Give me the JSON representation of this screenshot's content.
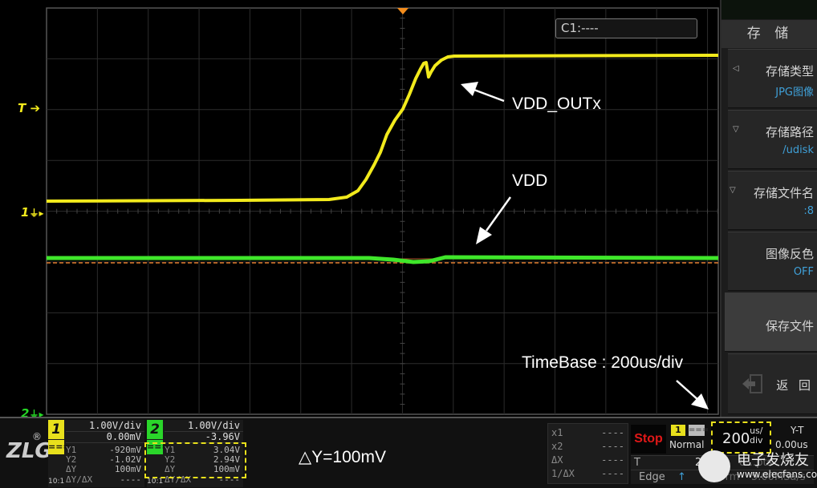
{
  "waveform": {
    "grid_divisions": {
      "horizontal": 14,
      "vertical": 8
    },
    "trigger_marker_color": "#f28c1c",
    "channels": [
      {
        "id": 1,
        "name": "VDD_OUTx",
        "color": "#f2ea1c",
        "marker_label": "1",
        "trace": "rising step from low level to high level near trigger point"
      },
      {
        "id": 2,
        "name": "VDD",
        "color": "#3fe62a",
        "marker_label": "2",
        "trace": "flat line with small dip (~100mV) at trigger point"
      }
    ],
    "trigger_level_marker_label": "T",
    "cursor_line_color": "#e07a2c"
  },
  "cursor_box": {
    "label": "C1:----"
  },
  "annotations": {
    "vdd_outx": "VDD_OUTx",
    "vdd": "VDD",
    "timebase": "TimeBase : 200us/div",
    "delta_y": "△Y=100mV"
  },
  "menu": {
    "title": "存 储",
    "items": [
      {
        "label": "存储类型",
        "value": "JPG图像",
        "caret": "◁"
      },
      {
        "label": "存储路径",
        "value": "/udisk",
        "caret": "▽"
      },
      {
        "label": "存储文件名",
        "value": ":8",
        "caret": "▽"
      },
      {
        "label": "图像反色",
        "value": "OFF"
      },
      {
        "label": "保存文件"
      },
      {
        "label": "返 回",
        "icon": "exit-icon"
      }
    ]
  },
  "status": {
    "logo": "ZLG",
    "logo_reg": "®",
    "ch1": {
      "num": "1",
      "scale": "1.00V/div",
      "offset": "0.00mV",
      "coupling": "===",
      "probe": "10:1",
      "color": "#e8e01c",
      "rows": [
        {
          "k": "Y1",
          "v": "-920mV"
        },
        {
          "k": "Y2",
          "v": "-1.02V"
        },
        {
          "k": "ΔY",
          "v": "100mV"
        },
        {
          "k": "ΔY/ΔX",
          "v": "----"
        }
      ]
    },
    "ch2": {
      "num": "2",
      "scale": "1.00V/div",
      "offset": "-3.96V",
      "coupling": "===",
      "probe": "10:1",
      "color": "#2ad62a",
      "rows": [
        {
          "k": "Y1",
          "v": "3.04V"
        },
        {
          "k": "Y2",
          "v": "2.94V"
        },
        {
          "k": "ΔY",
          "v": "100mV"
        },
        {
          "k": "ΔY/ΔX",
          "v": "----"
        }
      ]
    },
    "xcursors": [
      {
        "k": "x1",
        "v": "----"
      },
      {
        "k": "x2",
        "v": "----"
      },
      {
        "k": "ΔX",
        "v": "----"
      },
      {
        "k": "1/ΔX",
        "v": "----"
      }
    ],
    "run_state": "Stop",
    "trigger_source": "1",
    "trigger_coupling": "===",
    "trigger_mode": "Normal",
    "timebase_value": "200",
    "timebase_unit_top": "us/",
    "timebase_unit_bottom": "div",
    "display_mode": "Y-T",
    "horizontal_position": "0.00us",
    "trigger_label": "T",
    "trigger_level": "2.04V",
    "memory_depth": "8…pts",
    "trigger_type": "Edge",
    "edge_icon": "↑",
    "sweep": "Norm",
    "sample_rate": "5.00MSa/s"
  },
  "watermark": {
    "cn": "电子发烧友",
    "url": "www.elecfans.com"
  }
}
